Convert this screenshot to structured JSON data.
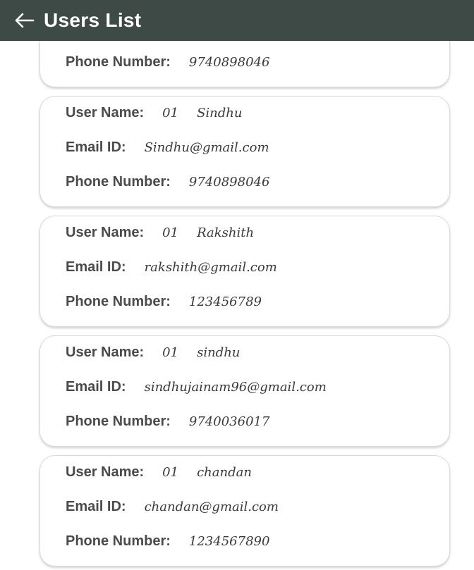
{
  "header": {
    "title": "Users List",
    "back_icon": "arrow-left-icon",
    "background": "#3d4a46"
  },
  "labels": {
    "user_name": "User Name:",
    "email_id": "Email ID:",
    "phone_number": "Phone Number:"
  },
  "users": [
    {
      "id": "",
      "name": "",
      "email": "",
      "phone": "9740898046"
    },
    {
      "id": "01",
      "name": "Sindhu",
      "email": "Sindhu@gmail.com",
      "phone": "9740898046"
    },
    {
      "id": "01",
      "name": "Rakshith",
      "email": "rakshith@gmail.com",
      "phone": "123456789"
    },
    {
      "id": "01",
      "name": "sindhu",
      "email": "sindhujainam96@gmail.com",
      "phone": "9740036017"
    },
    {
      "id": "01",
      "name": "chandan",
      "email": "chandan@gmail.com",
      "phone": "1234567890"
    }
  ]
}
